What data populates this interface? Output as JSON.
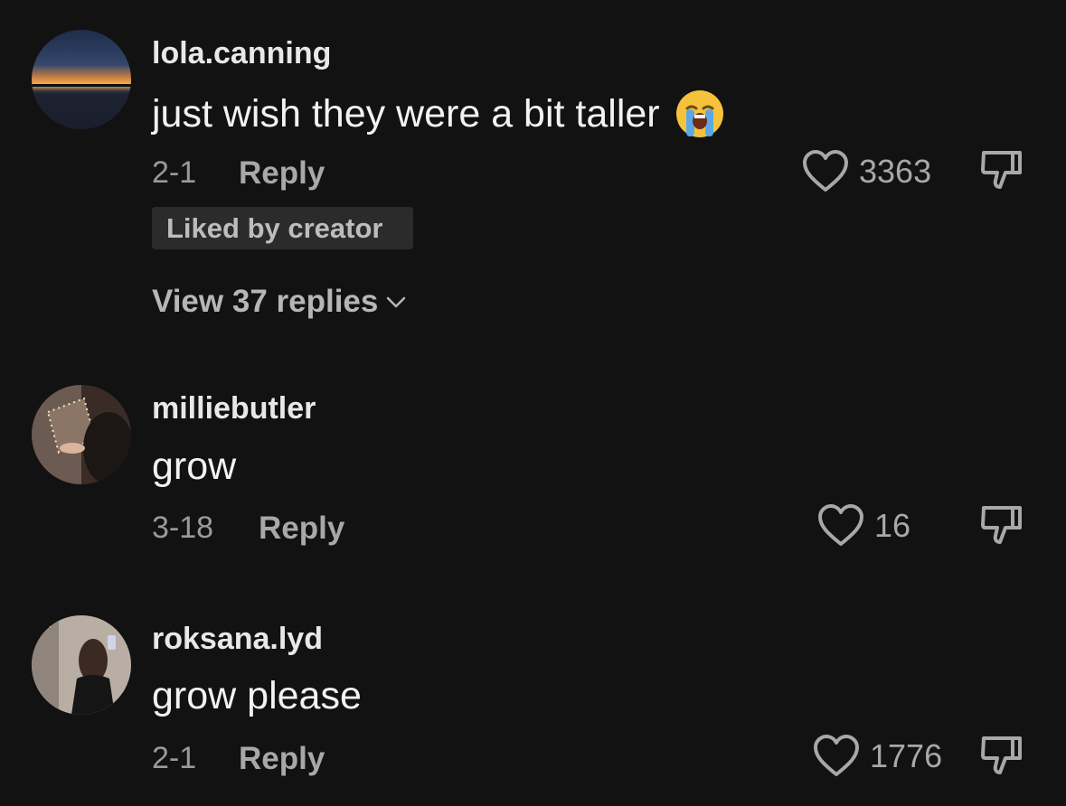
{
  "comments": [
    {
      "username": "lola.canning",
      "text": "just wish they were a bit taller",
      "emoji": "loudly-crying-face",
      "date": "2-1",
      "reply_label": "Reply",
      "likes": "3363",
      "badge": "Liked by creator",
      "view_replies": "View 37 replies"
    },
    {
      "username": "milliebutler",
      "text": "grow",
      "date": "3-18",
      "reply_label": "Reply",
      "likes": "16"
    },
    {
      "username": "roksana.lyd",
      "text": "grow please",
      "date": "2-1",
      "reply_label": "Reply",
      "likes": "1776"
    }
  ],
  "colors": {
    "background": "#121212",
    "text": "#f2f2f2",
    "muted": "#9a9a9a",
    "badge_bg": "#2b2b2b"
  }
}
